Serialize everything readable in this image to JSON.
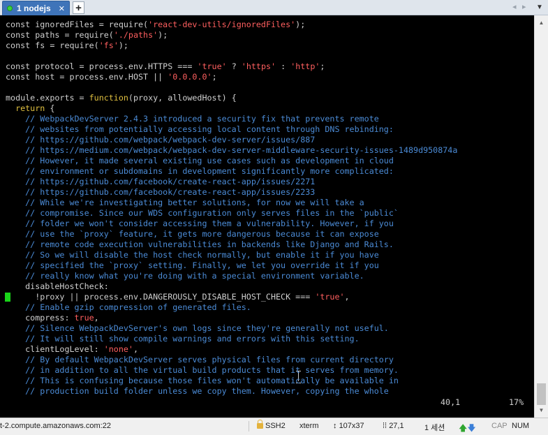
{
  "tabbar": {
    "tab_label": "1 nodejs",
    "close_glyph": "✕",
    "add_glyph": "+",
    "prev_glyph": "◂",
    "next_glyph": "▸",
    "menu_glyph": "▼",
    "tab_dot_color": "#3bd43b",
    "tab_color": "#3f74b9"
  },
  "terminal": {
    "lines": [
      [
        [
          "t",
          "const ignoredFiles = require("
        ],
        [
          "s",
          "'react-dev-utils/ignoredFiles'"
        ],
        [
          "t",
          ");"
        ]
      ],
      [
        [
          "t",
          "const paths = require("
        ],
        [
          "s",
          "'./paths'"
        ],
        [
          "t",
          ");"
        ]
      ],
      [
        [
          "t",
          "const fs = require("
        ],
        [
          "s",
          "'fs'"
        ],
        [
          "t",
          ");"
        ]
      ],
      [],
      [
        [
          "t",
          "const protocol = process.env.HTTPS === "
        ],
        [
          "s",
          "'true'"
        ],
        [
          "t",
          " ? "
        ],
        [
          "s",
          "'https'"
        ],
        [
          "t",
          " : "
        ],
        [
          "s",
          "'http'"
        ],
        [
          "t",
          ";"
        ]
      ],
      [
        [
          "t",
          "const host = process.env.HOST || "
        ],
        [
          "s",
          "'0.0.0.0'"
        ],
        [
          "t",
          ";"
        ]
      ],
      [],
      [
        [
          "t",
          "module.exports = "
        ],
        [
          "k",
          "function"
        ],
        [
          "t",
          "(proxy, allowedHost) {"
        ]
      ],
      [
        [
          "k",
          "  return"
        ],
        [
          "t",
          " {"
        ]
      ],
      [
        [
          "c",
          "    // WebpackDevServer 2.4.3 introduced a security fix that prevents remote"
        ]
      ],
      [
        [
          "c",
          "    // websites from potentially accessing local content through DNS rebinding:"
        ]
      ],
      [
        [
          "c",
          "    // https://github.com/webpack/webpack-dev-server/issues/887"
        ]
      ],
      [
        [
          "c",
          "    // https://medium.com/webpack/webpack-dev-server-middleware-security-issues-1489d950874a"
        ]
      ],
      [
        [
          "c",
          "    // However, it made several existing use cases such as development in cloud"
        ]
      ],
      [
        [
          "c",
          "    // environment or subdomains in development significantly more complicated:"
        ]
      ],
      [
        [
          "c",
          "    // https://github.com/facebook/create-react-app/issues/2271"
        ]
      ],
      [
        [
          "c",
          "    // https://github.com/facebook/create-react-app/issues/2233"
        ]
      ],
      [
        [
          "c",
          "    // While we're investigating better solutions, for now we will take a"
        ]
      ],
      [
        [
          "c",
          "    // compromise. Since our WDS configuration only serves files in the `public`"
        ]
      ],
      [
        [
          "c",
          "    // folder we won't consider accessing them a vulnerability. However, if you"
        ]
      ],
      [
        [
          "c",
          "    // use the `proxy` feature, it gets more dangerous because it can expose"
        ]
      ],
      [
        [
          "c",
          "    // remote code execution vulnerabilities in backends like Django and Rails."
        ]
      ],
      [
        [
          "c",
          "    // So we will disable the host check normally, but enable it if you have"
        ]
      ],
      [
        [
          "c",
          "    // specified the `proxy` setting. Finally, we let you override it if you"
        ]
      ],
      [
        [
          "c",
          "    // really know what you're doing with a special environment variable."
        ]
      ],
      [
        [
          "t",
          "    disableHostCheck:"
        ]
      ],
      [
        [
          "t",
          "      !proxy || process.env.DANGEROUSLY_DISABLE_HOST_CHECK === "
        ],
        [
          "s",
          "'true'"
        ],
        [
          "t",
          ","
        ]
      ],
      [
        [
          "c",
          "    // Enable gzip compression of generated files."
        ]
      ],
      [
        [
          "t",
          "    compress: "
        ],
        [
          "s",
          "true"
        ],
        [
          "t",
          ","
        ]
      ],
      [
        [
          "c",
          "    // Silence WebpackDevServer's own logs since they're generally not useful."
        ]
      ],
      [
        [
          "c",
          "    // It will still show compile warnings and errors with this setting."
        ]
      ],
      [
        [
          "t",
          "    clientLogLevel: "
        ],
        [
          "s",
          "'none'"
        ],
        [
          "t",
          ","
        ]
      ],
      [
        [
          "c",
          "    // By default WebpackDevServer serves physical files from current directory"
        ]
      ],
      [
        [
          "c",
          "    // in addition to all the virtual build products that it serves from memory."
        ]
      ],
      [
        [
          "c",
          "    // This is confusing because those files won't automatically be available in"
        ]
      ],
      [
        [
          "c",
          "    // production build folder unless we copy them. However, copying the whole"
        ]
      ]
    ],
    "cursor_position": "40,1",
    "scroll_percent": "17%",
    "colors": {
      "background": "#000000",
      "text": "#d0d0d0",
      "string": "#ff5f5f",
      "keyword": "#e0c040",
      "comment": "#4b8bd6",
      "cursor": "#19d419"
    }
  },
  "scrollbar": {
    "up_glyph": "▲",
    "down_glyph": "▼"
  },
  "statusbar": {
    "host": "t-2.compute.amazonaws.com:22",
    "protocol": "SSH2",
    "terminal_type": "xterm",
    "size_glyph": "↕",
    "size": "107x37",
    "position_glyph": "⁞⁞",
    "position": "27,1",
    "sessions": "1 세션",
    "caps": "CAP",
    "num": "NUM"
  }
}
